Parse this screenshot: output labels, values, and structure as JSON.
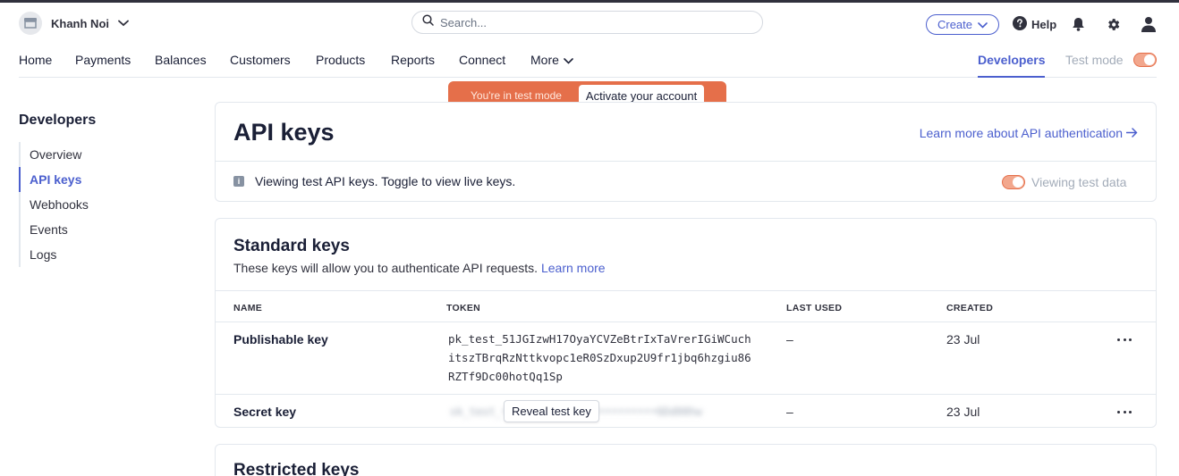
{
  "header": {
    "account_name": "Khanh Noi",
    "search_placeholder": "Search...",
    "create_label": "Create",
    "help_label": "Help"
  },
  "nav": {
    "items": [
      "Home",
      "Payments",
      "Balances",
      "Customers",
      "Products",
      "Reports",
      "Connect",
      "More"
    ],
    "developers": "Developers",
    "test_mode": "Test mode"
  },
  "banner": {
    "text": "You're in test mode",
    "button": "Activate your account"
  },
  "sidebar": {
    "title": "Developers",
    "items": [
      {
        "label": "Overview",
        "active": false
      },
      {
        "label": "API keys",
        "active": true
      },
      {
        "label": "Webhooks",
        "active": false
      },
      {
        "label": "Events",
        "active": false
      },
      {
        "label": "Logs",
        "active": false
      }
    ]
  },
  "page": {
    "title": "API keys",
    "learn_link": "Learn more about API authentication",
    "info_text": "Viewing test API keys. Toggle to view live keys.",
    "viewing_label": "Viewing test data"
  },
  "standard_keys": {
    "title": "Standard keys",
    "description": "These keys will allow you to authenticate API requests.",
    "learn_more": "Learn more",
    "columns": [
      "NAME",
      "TOKEN",
      "LAST USED",
      "CREATED"
    ],
    "rows": [
      {
        "name": "Publishable key",
        "token": "pk_test_51JGIzwH17OyaYCVZeBtrIxTaVrerIGiWCuchitszTBrqRzNttkvopc1eR0SzDxup2U9fr1jbq6hzgiu86RZTf9Dc00hotQq1Sp",
        "last_used": "–",
        "created": "23 Jul"
      },
      {
        "name": "Secret key",
        "token_hidden": "sk_test_••••••••••••••••••••••••6Dd00hw",
        "reveal_label": "Reveal test key",
        "last_used": "–",
        "created": "23 Jul"
      }
    ]
  },
  "restricted_keys": {
    "title": "Restricted keys"
  },
  "colors": {
    "accent": "#4b5fce",
    "test_orange": "#e56f4a",
    "border": "#e3e8ee"
  }
}
